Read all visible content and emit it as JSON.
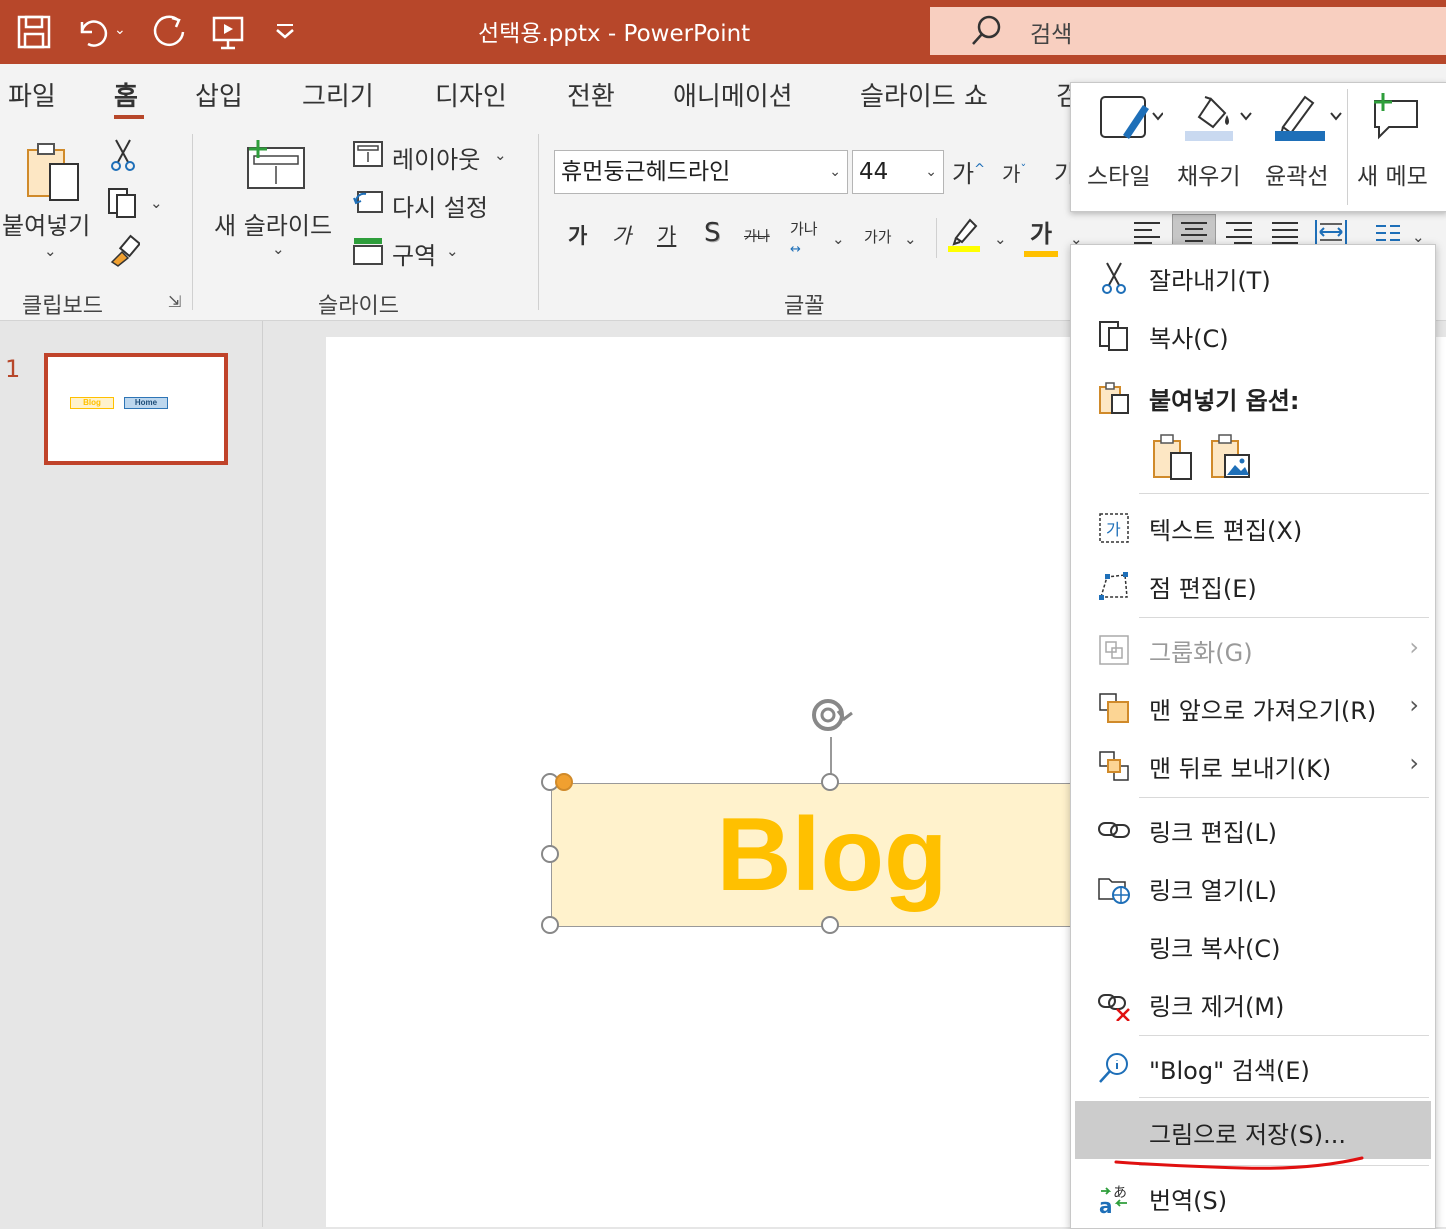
{
  "titlebar": {
    "document_title": "선택용.pptx  -  PowerPoint",
    "search_label": "검색",
    "icons": [
      "save-icon",
      "undo-icon",
      "redo-icon",
      "present-from-start-icon",
      "customize-qat-icon",
      "search-icon"
    ]
  },
  "tabs": [
    "파일",
    "홈",
    "삽입",
    "그리기",
    "디자인",
    "전환",
    "애니메이션",
    "슬라이드 쇼",
    "검"
  ],
  "active_tab": "홈",
  "clipboard": {
    "paste_label": "붙여넣기",
    "group_label": "클립보드"
  },
  "slides_group": {
    "new_slide_label": "새 슬라이드",
    "layout_label": "레이아웃",
    "reset_label": "다시 설정",
    "section_label": "구역",
    "group_label": "슬라이드"
  },
  "font": {
    "font_name": "휴먼둥근헤드라인",
    "font_size": "44",
    "grow_label": "가",
    "shrink_label": "가",
    "bold": "가",
    "italic": "가",
    "underline": "가",
    "shadow": "S",
    "strike": "가나",
    "spacing": "가나",
    "case": "가가",
    "font_color_glyph": "가",
    "clear_partial": "가",
    "group_label": "글꼴"
  },
  "mini_toolbar": {
    "style_label": "스타일",
    "fill_label": "채우기",
    "outline_label": "윤곽선",
    "new_comment_label": "새 메모"
  },
  "slide_panel": {
    "slide_number": "1",
    "thumb_blog": "Blog",
    "thumb_home": "Home"
  },
  "slide": {
    "shape_text": "Blog"
  },
  "context_menu": {
    "cut": "잘라내기(T)",
    "copy": "복사(C)",
    "paste_options": "붙여넣기 옵션:",
    "edit_text": "텍스트 편집(X)",
    "edit_points": "점 편집(E)",
    "group": "그룹화(G)",
    "bring_to_front": "맨 앞으로 가져오기(R)",
    "send_to_back": "맨 뒤로 보내기(K)",
    "edit_link": "링크 편집(L)",
    "open_link": "링크 열기(L)",
    "copy_link": "링크 복사(C)",
    "remove_link": "링크 제거(M)",
    "search": "\"Blog\" 검색(E)",
    "save_as_picture": "그림으로 저장(S)...",
    "translate": "번역(S)"
  },
  "colors": {
    "accent": "#b7472a",
    "search_bg": "#f8cfc0",
    "shape_fill": "#fff2cc",
    "shape_text": "#ffc000",
    "annotation": "#e01010"
  }
}
